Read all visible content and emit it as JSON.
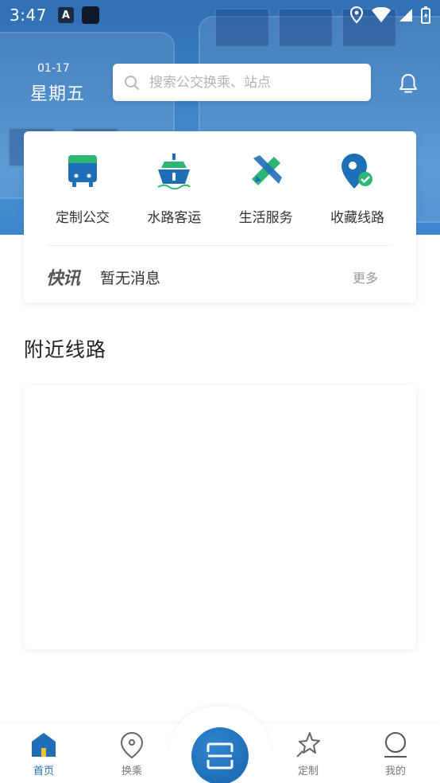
{
  "status_bar": {
    "time": "3:47",
    "notif_letter": "A"
  },
  "header": {
    "date": "01-17",
    "weekday": "星期五"
  },
  "search": {
    "placeholder": "搜索公交换乘、站点"
  },
  "services": [
    {
      "label": "定制公交",
      "icon": "custom-bus-icon"
    },
    {
      "label": "水路客运",
      "icon": "ferry-icon"
    },
    {
      "label": "生活服务",
      "icon": "life-service-icon"
    },
    {
      "label": "收藏线路",
      "icon": "favorite-route-icon"
    }
  ],
  "news": {
    "logo": "快讯",
    "message": "暂无消息",
    "more": "更多"
  },
  "nearby": {
    "title": "附近线路"
  },
  "bottom_nav": {
    "items": [
      {
        "label": "首页",
        "icon": "home-icon",
        "active": true
      },
      {
        "label": "换乘",
        "icon": "location-pin-icon",
        "active": false
      },
      {
        "label": "",
        "icon": "scan-icon",
        "active": false
      },
      {
        "label": "定制",
        "icon": "star-icon",
        "active": false
      },
      {
        "label": "我的",
        "icon": "profile-icon",
        "active": false
      }
    ]
  },
  "colors": {
    "primary": "#1f6fb7",
    "hero": "#3b7fc4",
    "accent_green": "#2bb673"
  }
}
